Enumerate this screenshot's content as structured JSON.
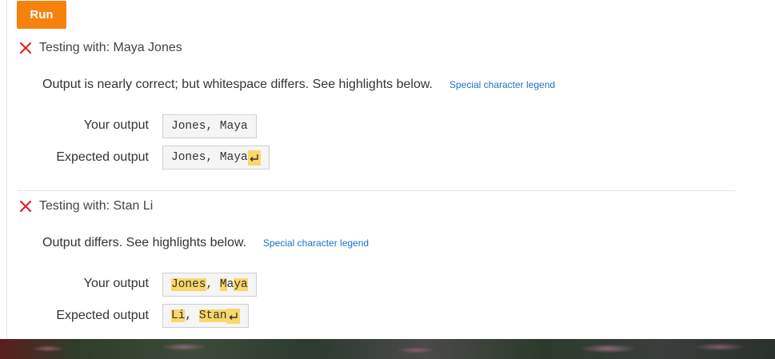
{
  "toolbar": {
    "run_label": "Run"
  },
  "tests": [
    {
      "header": "Testing with: Maya Jones",
      "message": "Output is nearly correct; but whitespace differs. See highlights below.",
      "legend_link": "Special character legend",
      "your_output_label": "Your output",
      "your_output": "Jones, Maya",
      "expected_output_label": "Expected output",
      "expected_output": "Jones, Maya"
    },
    {
      "header": "Testing with: Stan Li",
      "message": "Output differs. See highlights below.",
      "legend_link": "Special character legend",
      "your_output_label": "Your output",
      "your_output_parts": [
        "Jones",
        ", ",
        "M",
        "a",
        "ya"
      ],
      "expected_output_label": "Expected output",
      "expected_output_parts": [
        "Li",
        ", ",
        "Stan"
      ]
    }
  ],
  "colors": {
    "accent": "#f6820d",
    "fail_icon": "#e0242f",
    "highlight": "#f8d86a",
    "link": "#1a73c9"
  },
  "icons": {
    "fail": "close-x-icon",
    "newline": "return-arrow-icon"
  }
}
